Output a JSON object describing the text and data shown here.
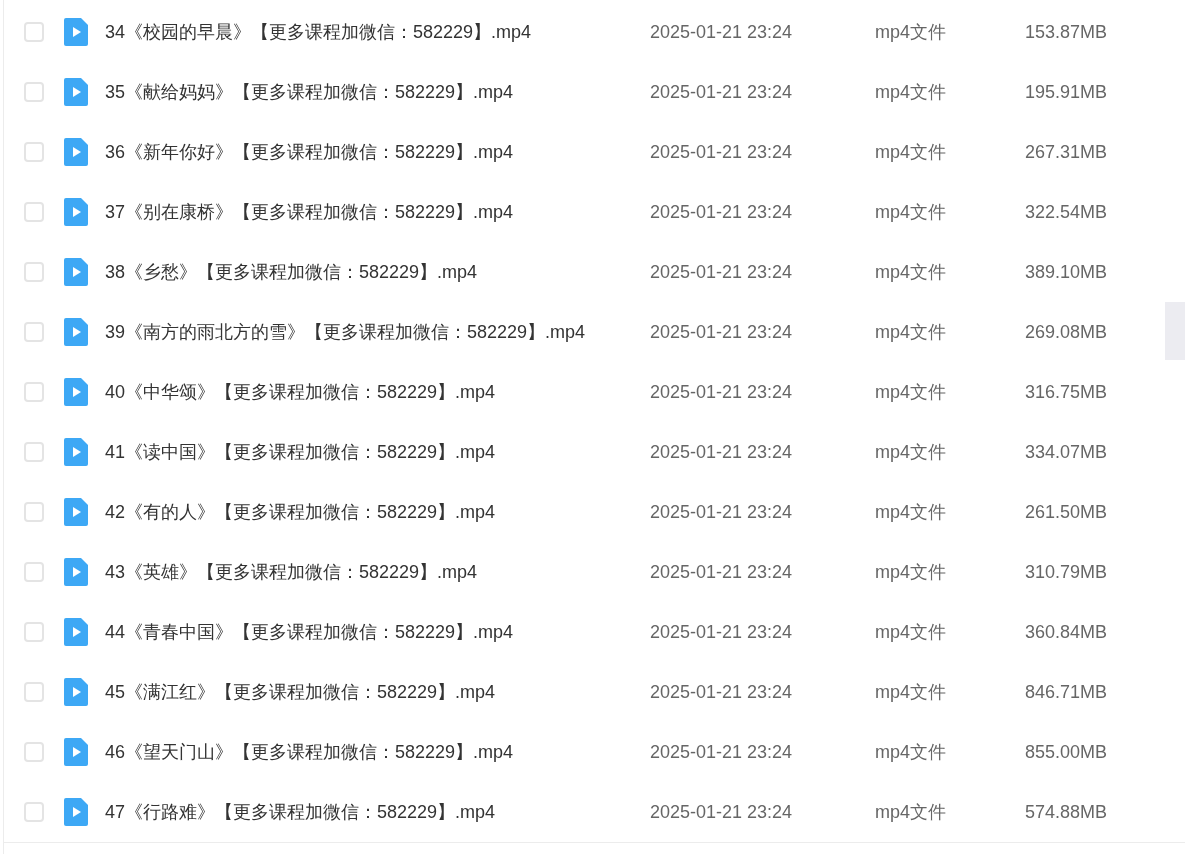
{
  "files": [
    {
      "name": "34《校园的早晨》【更多课程加微信：582229】.mp4",
      "date": "2025-01-21 23:24",
      "type": "mp4文件",
      "size": "153.87MB",
      "checked": false
    },
    {
      "name": "35《献给妈妈》【更多课程加微信：582229】.mp4",
      "date": "2025-01-21 23:24",
      "type": "mp4文件",
      "size": "195.91MB",
      "checked": false
    },
    {
      "name": "36《新年你好》【更多课程加微信：582229】.mp4",
      "date": "2025-01-21 23:24",
      "type": "mp4文件",
      "size": "267.31MB",
      "checked": false
    },
    {
      "name": "37《别在康桥》【更多课程加微信：582229】.mp4",
      "date": "2025-01-21 23:24",
      "type": "mp4文件",
      "size": "322.54MB",
      "checked": false
    },
    {
      "name": "38《乡愁》【更多课程加微信：582229】.mp4",
      "date": "2025-01-21 23:24",
      "type": "mp4文件",
      "size": "389.10MB",
      "checked": false
    },
    {
      "name": "39《南方的雨北方的雪》【更多课程加微信：582229】.mp4",
      "date": "2025-01-21 23:24",
      "type": "mp4文件",
      "size": "269.08MB",
      "checked": false
    },
    {
      "name": "40《中华颂》【更多课程加微信：582229】.mp4",
      "date": "2025-01-21 23:24",
      "type": "mp4文件",
      "size": "316.75MB",
      "checked": false
    },
    {
      "name": "41《读中国》【更多课程加微信：582229】.mp4",
      "date": "2025-01-21 23:24",
      "type": "mp4文件",
      "size": "334.07MB",
      "checked": false
    },
    {
      "name": "42《有的人》【更多课程加微信：582229】.mp4",
      "date": "2025-01-21 23:24",
      "type": "mp4文件",
      "size": "261.50MB",
      "checked": false
    },
    {
      "name": "43《英雄》【更多课程加微信：582229】.mp4",
      "date": "2025-01-21 23:24",
      "type": "mp4文件",
      "size": "310.79MB",
      "checked": false
    },
    {
      "name": "44《青春中国》【更多课程加微信：582229】.mp4",
      "date": "2025-01-21 23:24",
      "type": "mp4文件",
      "size": "360.84MB",
      "checked": false
    },
    {
      "name": "45《满江红》【更多课程加微信：582229】.mp4",
      "date": "2025-01-21 23:24",
      "type": "mp4文件",
      "size": "846.71MB",
      "checked": false
    },
    {
      "name": "46《望天门山》【更多课程加微信：582229】.mp4",
      "date": "2025-01-21 23:24",
      "type": "mp4文件",
      "size": "855.00MB",
      "checked": false
    },
    {
      "name": "47《行路难》【更多课程加微信：582229】.mp4",
      "date": "2025-01-21 23:24",
      "type": "mp4文件",
      "size": "574.88MB",
      "checked": false
    }
  ]
}
